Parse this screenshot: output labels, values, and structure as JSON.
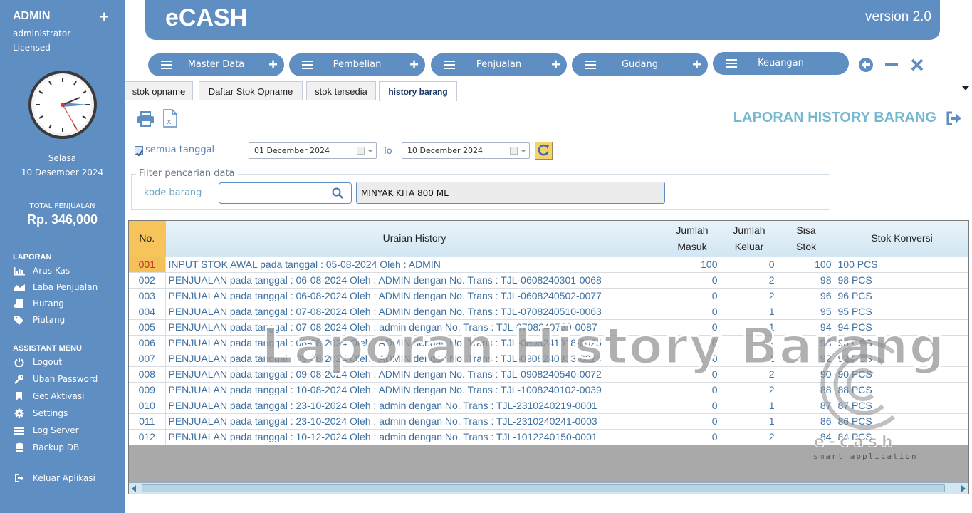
{
  "sidebar": {
    "user": "ADMIN",
    "plus": "+",
    "role": "administrator",
    "license": "Licensed",
    "day": "Selasa",
    "date": "10 Desember 2024",
    "total_label": "TOTAL PENJUALAN",
    "total_value": "Rp. 346,000",
    "laporan_heading": "LAPORAN",
    "laporan_items": [
      {
        "label": "Arus Kas",
        "icon": "bar-chart-icon"
      },
      {
        "label": "Laba Penjualan",
        "icon": "area-chart-icon"
      },
      {
        "label": "Hutang",
        "icon": "book-icon"
      },
      {
        "label": "Piutang",
        "icon": "tags-icon"
      }
    ],
    "assistant_heading": "ASSISTANT MENU",
    "assistant_items": [
      {
        "label": "Logout",
        "icon": "power-icon"
      },
      {
        "label": "Ubah Password",
        "icon": "key-icon"
      },
      {
        "label": "Get Aktivasi",
        "icon": "bookmark-icon"
      },
      {
        "label": "Settings",
        "icon": "gear-icon"
      },
      {
        "label": "Log Server",
        "icon": "server-icon"
      },
      {
        "label": "Backup DB",
        "icon": "database-icon"
      }
    ],
    "exit_label": "Keluar Aplikasi"
  },
  "header": {
    "title": "eCASH",
    "version": "version 2.0"
  },
  "menus": [
    {
      "label": "Master Data",
      "plus": "+"
    },
    {
      "label": "Pembelian",
      "plus": "+"
    },
    {
      "label": "Penjualan",
      "plus": "+"
    },
    {
      "label": "Gudang",
      "plus": "+"
    },
    {
      "label": "Keuangan",
      "plus": ""
    }
  ],
  "tabs": [
    {
      "label": "stok opname",
      "active": false
    },
    {
      "label": "Daftar Stok Opname",
      "active": false
    },
    {
      "label": "stok tersedia",
      "active": false
    },
    {
      "label": "history barang",
      "active": true
    }
  ],
  "report": {
    "title": "LAPORAN HISTORY BARANG",
    "all_dates_label": "semua tanggal",
    "all_dates_checked": true,
    "date_from": "01 December  2024",
    "date_to_label": "To",
    "date_to": "10 December  2024",
    "filter_legend": "Filter pencarian data",
    "kode_label": "kode barang",
    "kode_value": "",
    "nama_barang": "MINYAK KITA 800 ML"
  },
  "table": {
    "headers": {
      "no": "No.",
      "uraian": "Uraian History",
      "masuk_1": "Jumlah",
      "masuk_2": "Masuk",
      "keluar_1": "Jumlah",
      "keluar_2": "Keluar",
      "sisa_1": "Sisa",
      "sisa_2": "Stok",
      "konversi": "Stok Konversi"
    },
    "rows": [
      {
        "no": "001",
        "uraian": "INPUT STOK AWAL pada tanggal : 05-08-2024 Oleh : ADMIN",
        "masuk": "100",
        "keluar": "0",
        "sisa": "100",
        "konversi": "100 PCS"
      },
      {
        "no": "002",
        "uraian": "PENJUALAN pada tanggal : 06-08-2024 Oleh : ADMIN dengan No. Trans : TJL-0608240301-0068",
        "masuk": "0",
        "keluar": "2",
        "sisa": "98",
        "konversi": "98 PCS"
      },
      {
        "no": "003",
        "uraian": "PENJUALAN pada tanggal : 06-08-2024 Oleh : ADMIN dengan No. Trans : TJL-0608240502-0077",
        "masuk": "0",
        "keluar": "2",
        "sisa": "96",
        "konversi": "96 PCS"
      },
      {
        "no": "004",
        "uraian": "PENJUALAN pada tanggal : 07-08-2024 Oleh : ADMIN dengan No. Trans : TJL-0708240510-0063",
        "masuk": "0",
        "keluar": "1",
        "sisa": "95",
        "konversi": "95 PCS"
      },
      {
        "no": "005",
        "uraian": "PENJUALAN pada tanggal : 07-08-2024 Oleh : admin dengan No. Trans : TJL-0708240739-0087",
        "masuk": "0",
        "keluar": "1",
        "sisa": "94",
        "konversi": "94 PCS"
      },
      {
        "no": "006",
        "uraian": "PENJUALAN pada tanggal : 08-08-2024 Oleh : ADMIN dengan No. Trans : TJL-0808241018-0025",
        "masuk": "0",
        "keluar": "1",
        "sisa": "93",
        "konversi": "93 PCS"
      },
      {
        "no": "007",
        "uraian": "PENJUALAN pada tanggal : 09-08-2024 Oleh : ADMIN dengan No. Trans : TJL-0908240933-0026",
        "masuk": "0",
        "keluar": "1",
        "sisa": "92",
        "konversi": "92 PCS"
      },
      {
        "no": "008",
        "uraian": "PENJUALAN pada tanggal : 09-08-2024 Oleh : ADMIN dengan No. Trans : TJL-0908240540-0072",
        "masuk": "0",
        "keluar": "2",
        "sisa": "90",
        "konversi": "90 PCS"
      },
      {
        "no": "009",
        "uraian": "PENJUALAN pada tanggal : 10-08-2024 Oleh : ADMIN dengan No. Trans : TJL-1008240102-0039",
        "masuk": "0",
        "keluar": "2",
        "sisa": "88",
        "konversi": "88 PCS"
      },
      {
        "no": "010",
        "uraian": "PENJUALAN pada tanggal : 23-10-2024 Oleh : admin dengan No. Trans : TJL-2310240219-0001",
        "masuk": "0",
        "keluar": "1",
        "sisa": "87",
        "konversi": "87 PCS"
      },
      {
        "no": "011",
        "uraian": "PENJUALAN pada tanggal : 23-10-2024 Oleh : admin dengan No. Trans : TJL-2310240241-0003",
        "masuk": "0",
        "keluar": "1",
        "sisa": "86",
        "konversi": "86 PCS"
      },
      {
        "no": "012",
        "uraian": "PENJUALAN pada tanggal : 10-12-2024 Oleh : admin dengan No. Trans : TJL-1012240150-0001",
        "masuk": "0",
        "keluar": "2",
        "sisa": "84",
        "konversi": "84 PCS"
      }
    ]
  },
  "overlay": {
    "title": "Laporan History Barang",
    "logo": "e-cash",
    "logo_sub": "smart application"
  },
  "colors": {
    "primary": "#5f8ec3",
    "accent_title": "#76b8cf",
    "selected_row": "#f3c05a",
    "row_text": "#3f71a3"
  }
}
